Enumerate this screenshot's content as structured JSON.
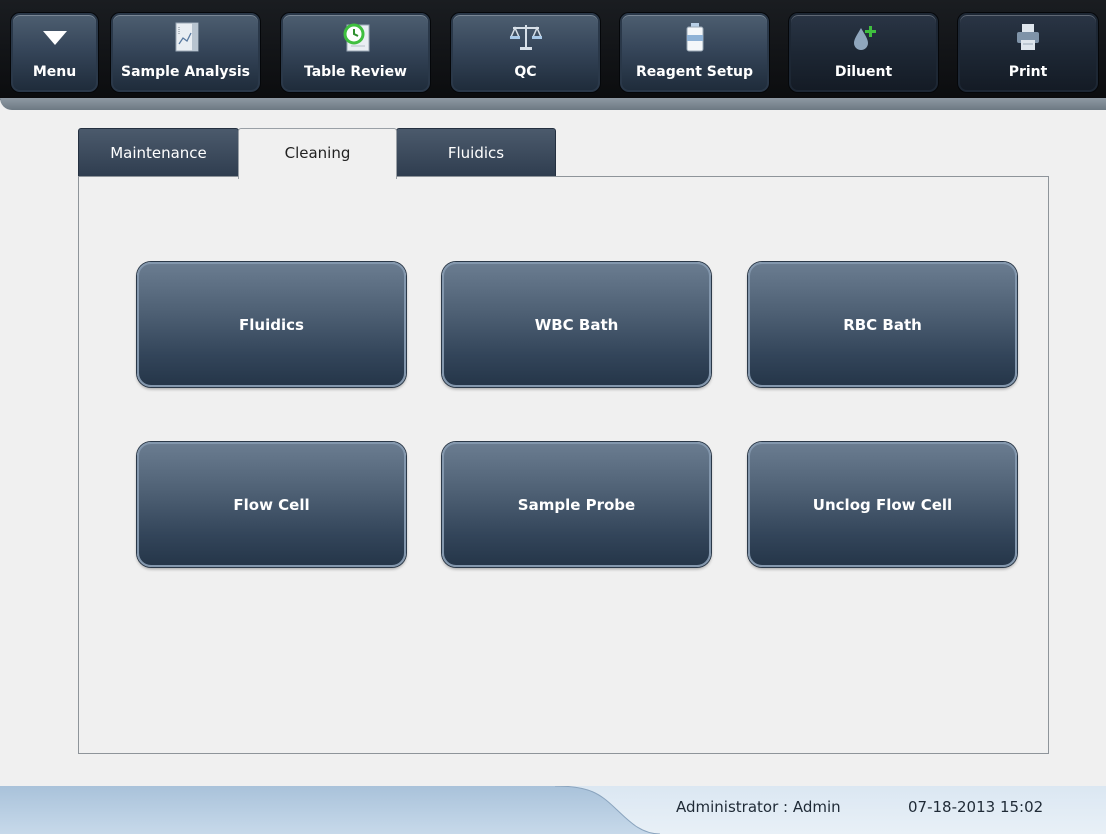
{
  "toolbar": {
    "menu": {
      "label": "Menu",
      "icon": "triangle-down-icon"
    },
    "sample_analysis": {
      "label": "Sample Analysis",
      "icon": "chart-document-icon"
    },
    "table_review": {
      "label": "Table Review",
      "icon": "clock-document-icon"
    },
    "qc": {
      "label": "QC",
      "icon": "balance-scale-icon"
    },
    "reagent_setup": {
      "label": "Reagent Setup",
      "icon": "reagent-bottle-icon"
    },
    "diluent": {
      "label": "Diluent",
      "icon": "droplet-plus-icon"
    },
    "print": {
      "label": "Print",
      "icon": "printer-icon"
    }
  },
  "tabs": [
    {
      "label": "Maintenance",
      "active": false
    },
    {
      "label": "Cleaning",
      "active": true
    },
    {
      "label": "Fluidics",
      "active": false
    }
  ],
  "actions": [
    {
      "label": "Fluidics"
    },
    {
      "label": "WBC Bath"
    },
    {
      "label": "RBC Bath"
    },
    {
      "label": "Flow Cell"
    },
    {
      "label": "Sample Probe"
    },
    {
      "label": "Unclog Flow Cell"
    }
  ],
  "status": {
    "user": "Administrator : Admin",
    "datetime": "07-18-2013 15:02"
  },
  "colors": {
    "accent": "#3a4c60",
    "button_text": "#ffffff",
    "icon_green": "#3fbf3f"
  }
}
